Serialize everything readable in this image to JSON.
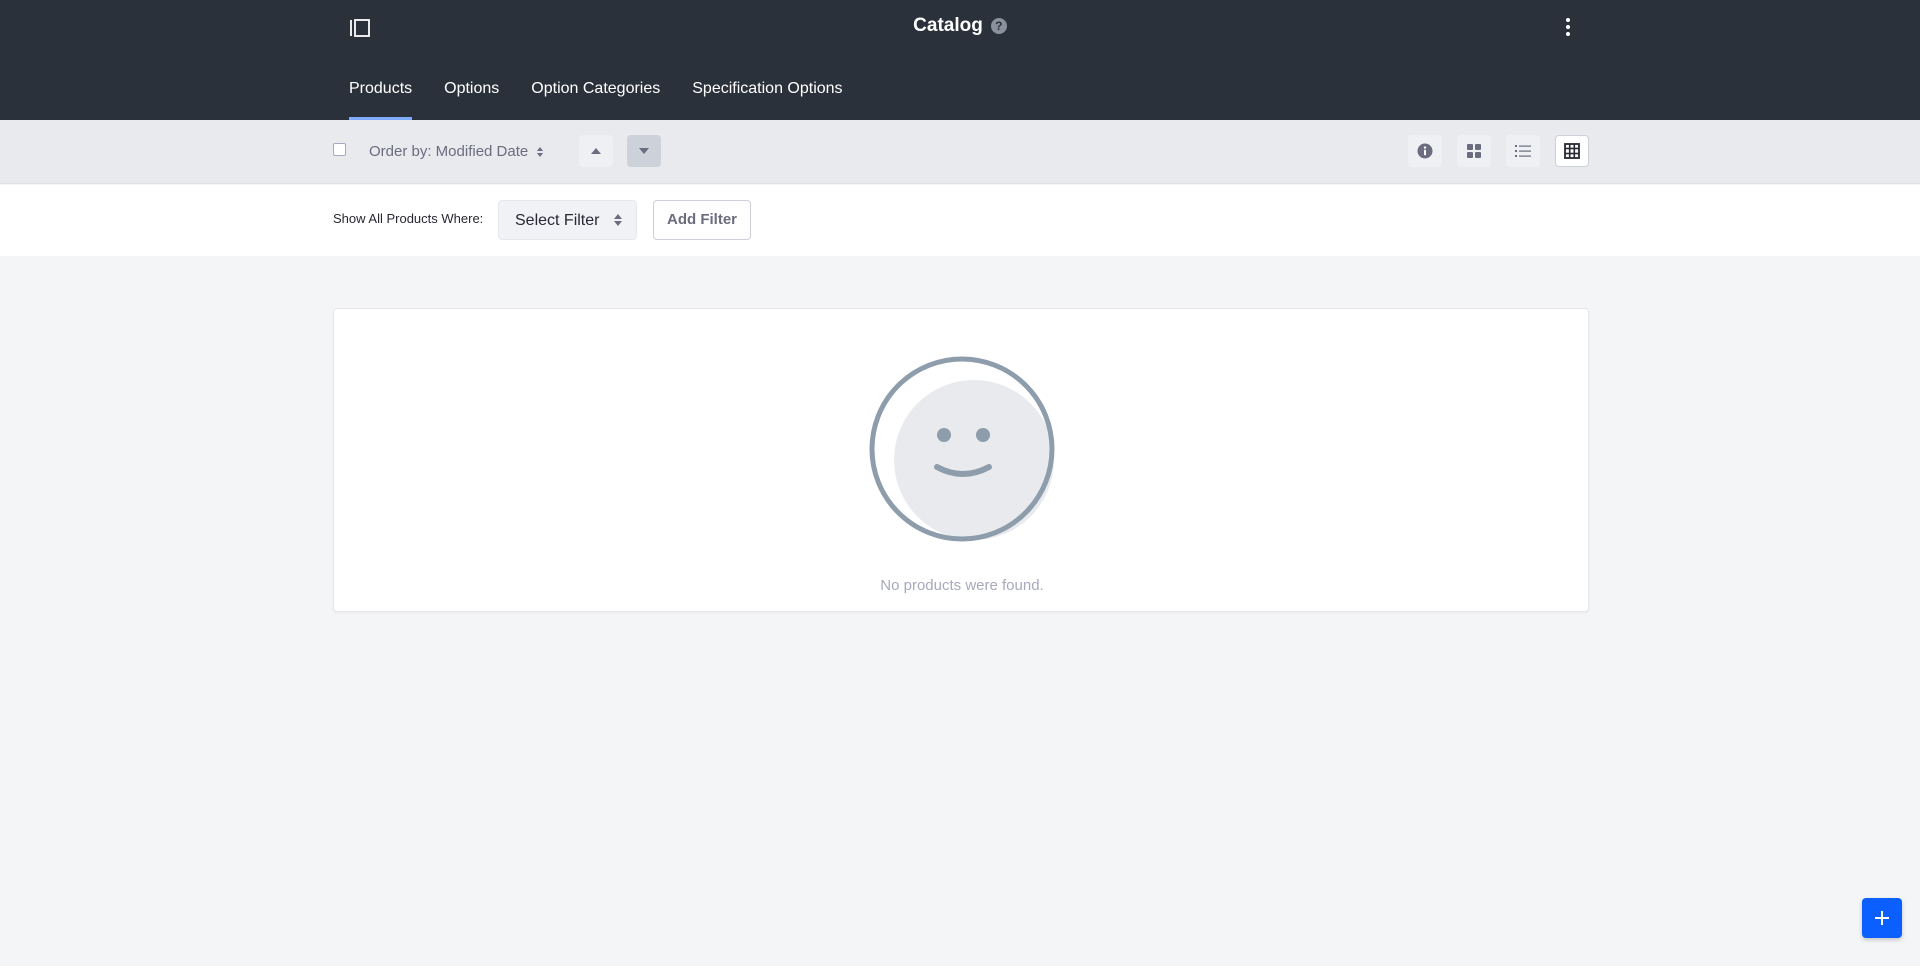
{
  "header": {
    "title": "Catalog",
    "help_glyph": "?",
    "sidebar_toggle_icon": "sidebar-toggle-icon",
    "options_icon": "ellipsis-vertical-icon"
  },
  "tabs": [
    {
      "label": "Products",
      "active": true
    },
    {
      "label": "Options",
      "active": false
    },
    {
      "label": "Option Categories",
      "active": false
    },
    {
      "label": "Specification Options",
      "active": false
    }
  ],
  "toolbar": {
    "order_by_label": "Order by: Modified Date",
    "sort_ascending_icon": "caret-up-icon",
    "sort_descending_icon": "caret-down-icon",
    "active_sort": "descending",
    "view_buttons": [
      "info-circle-icon",
      "cards-icon",
      "list-icon",
      "table-icon"
    ],
    "active_view": "table"
  },
  "filter": {
    "label": "Show All Products Where:",
    "select_value": "Select Filter",
    "add_button": "Add Filter"
  },
  "empty_state": {
    "message": "No products were found.",
    "illustration": "smiley-face-icon"
  },
  "fab": {
    "icon": "plus-icon"
  },
  "colors": {
    "topbar": "#2b313a",
    "accent": "#0b5fff",
    "tab_indicator": "#80acff"
  }
}
